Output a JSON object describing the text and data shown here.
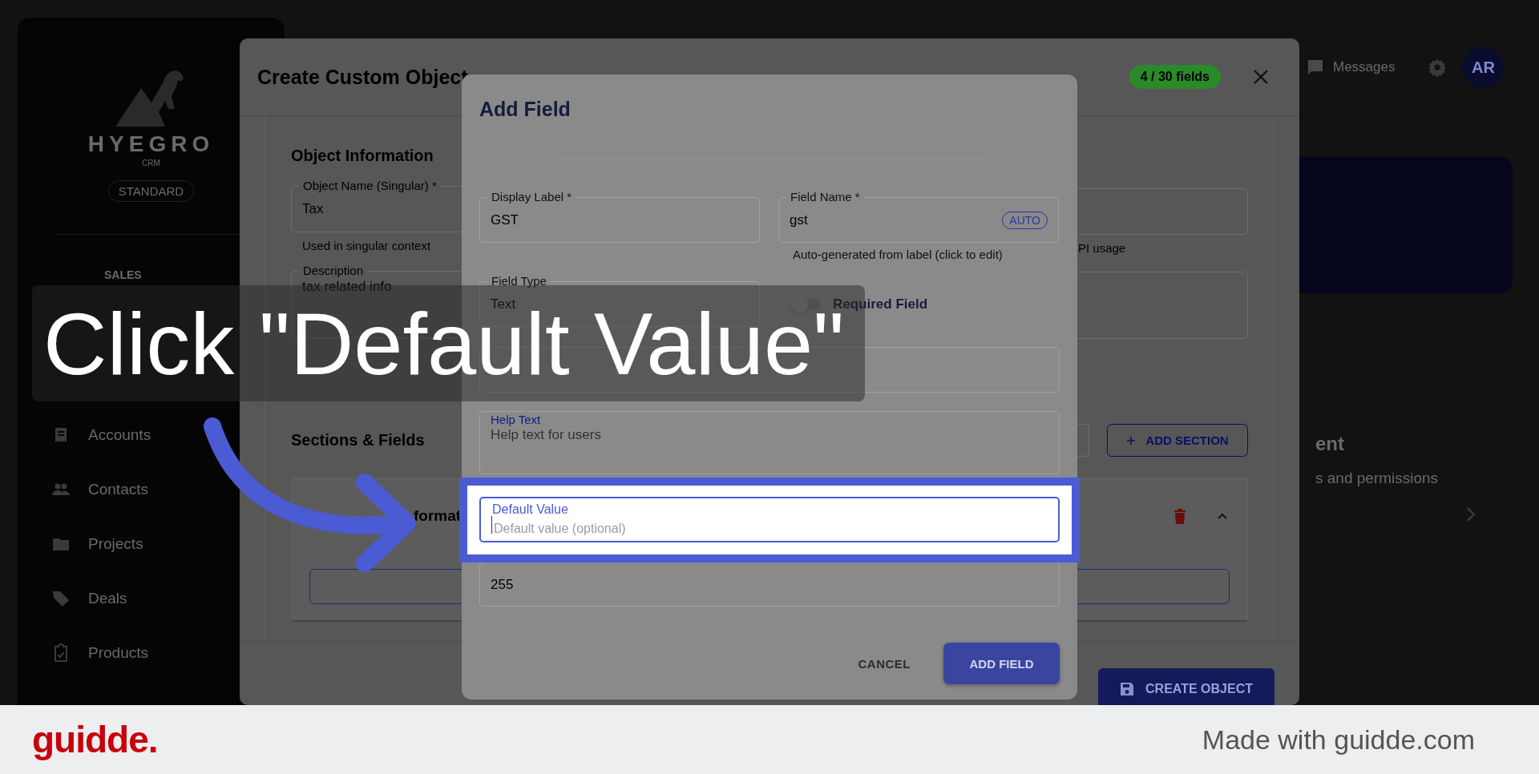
{
  "sidebar": {
    "logo_text": "HYEGRO",
    "logo_subtext": "CRM",
    "plan_badge": "STANDARD",
    "section_label": "SALES",
    "items": [
      {
        "label": "Accounts"
      },
      {
        "label": "Contacts"
      },
      {
        "label": "Projects"
      },
      {
        "label": "Deals"
      },
      {
        "label": "Products"
      }
    ]
  },
  "topbar": {
    "messages": "Messages",
    "avatar": "AR"
  },
  "background_panel": {
    "heading": "ent",
    "subtext": "s and permissions"
  },
  "create_dialog": {
    "title": "Create Custom Object",
    "field_count": "4 / 30 fields",
    "object_information": {
      "heading": "Object Information",
      "name_field": {
        "label": "Object Name (Singular) *",
        "value": "Tax",
        "helper": "Used in singular context"
      },
      "description_field": {
        "label": "Description",
        "value": "tax related info"
      },
      "right_helper": "PI usage"
    },
    "sections": {
      "heading": "Sections & Fields",
      "add_section": "ADD SECTION",
      "section_title": "format"
    },
    "create_button": "CREATE OBJECT"
  },
  "add_field_dialog": {
    "title": "Add Field",
    "display_label": {
      "label": "Display Label *",
      "value": "GST"
    },
    "field_name": {
      "label": "Field Name *",
      "value": "gst",
      "chip": "AUTO",
      "helper": "Auto-generated from label (click to edit)"
    },
    "field_type": {
      "label": "Field Type",
      "value": "Text"
    },
    "required_field": {
      "label": "Required Field",
      "on": false
    },
    "help_text": {
      "label": "Help Text",
      "placeholder": "Help text for users"
    },
    "default_value": {
      "label": "Default Value",
      "placeholder": "Default value (optional)",
      "focused": true
    },
    "max_length": {
      "value": "255"
    },
    "cancel": "CANCEL",
    "submit": "ADD FIELD"
  },
  "tooltip": {
    "text": "Click \"Default Value\""
  },
  "footer": {
    "logo": "guidde.",
    "credit": "Made with guidde.com"
  }
}
